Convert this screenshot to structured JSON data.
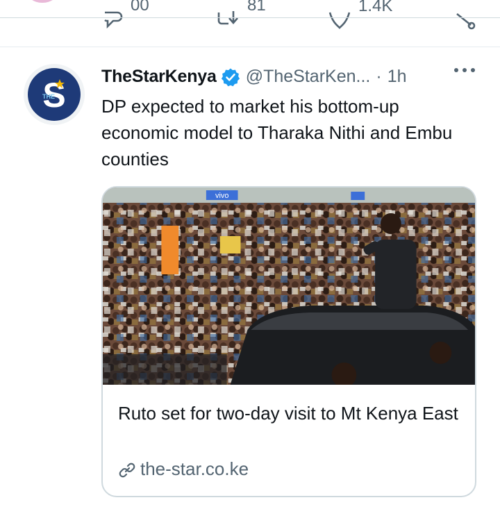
{
  "previous_tweet": {
    "actions": [
      {
        "icon": "reply-icon",
        "count": "00"
      },
      {
        "icon": "retweet-icon",
        "count": "81"
      },
      {
        "icon": "like-icon",
        "count": "1.4K"
      },
      {
        "icon": "share-icon",
        "count": ""
      }
    ]
  },
  "tweet": {
    "author_name": "TheStarKenya",
    "handle": "@TheStarKen...",
    "separator": "·",
    "time": "1h",
    "text": "DP expected to market his bottom-up economic model to Tharaka Nithi and Embu counties",
    "avatar_letter": "S",
    "avatar_small": "THE"
  },
  "card": {
    "title": "Ruto set for two-day visit to Mt Kenya East",
    "domain": "the-star.co.ke",
    "banner_text": "vivo"
  },
  "colors": {
    "verified": "#1d9bf0",
    "secondary_text": "#536471",
    "divider": "#cfd9de",
    "avatar_bg": "#1e3a78"
  }
}
